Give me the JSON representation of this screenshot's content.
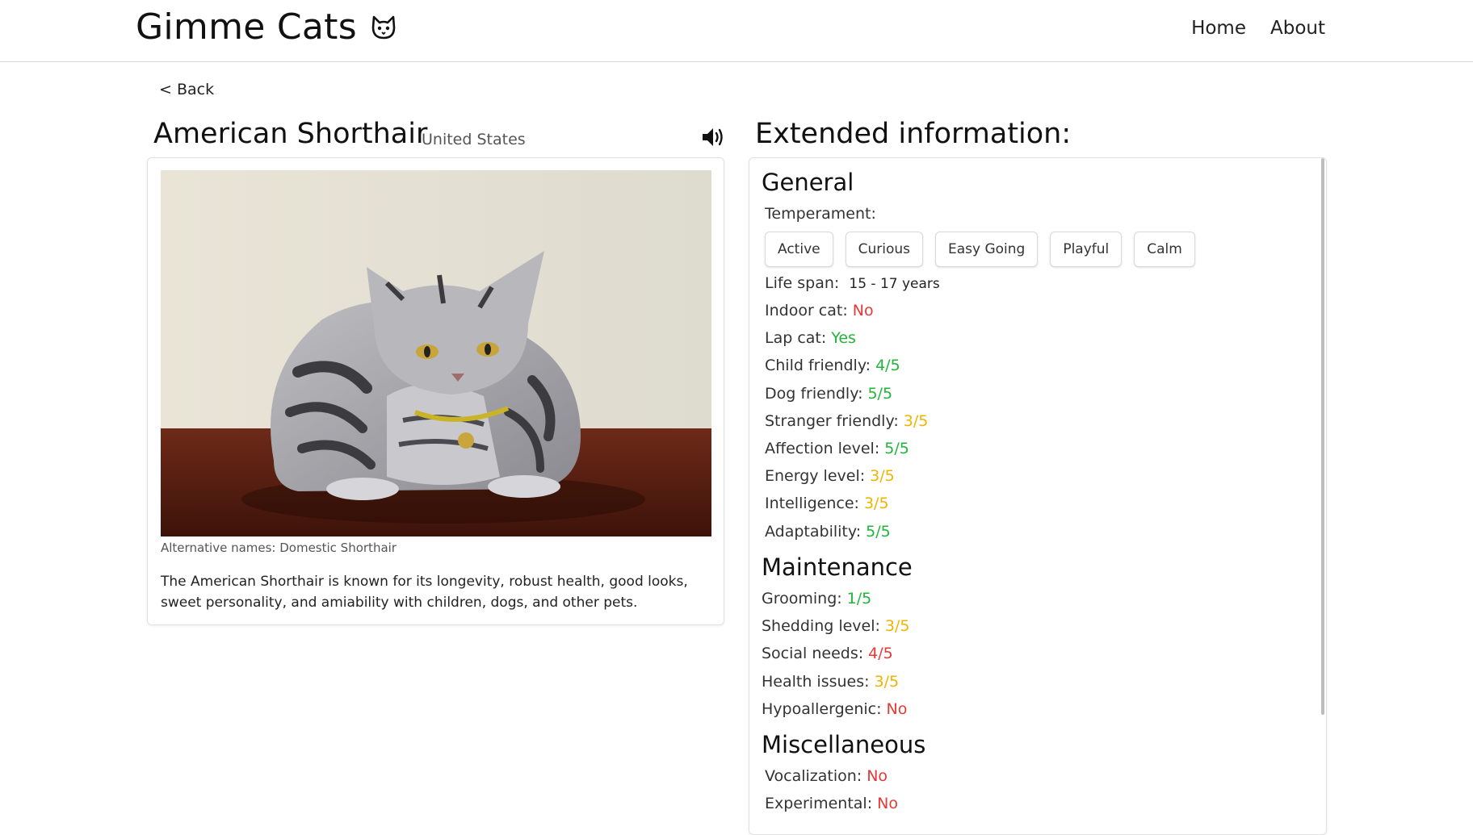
{
  "nav": {
    "brand": "Gimme Cats",
    "brand_icon": "cat-face-icon",
    "links": [
      "Home",
      "About"
    ]
  },
  "back_label": "< Back",
  "breed": {
    "name": "American Shorthair",
    "origin": "United States",
    "sound_icon": "speaker-icon",
    "alt_names": "Alternative names: Domestic Shorthair",
    "description": "The American Shorthair is known for its longevity, robust health, good looks, sweet personality, and amiability with children, dogs, and other pets."
  },
  "extended": {
    "title": "Extended information:",
    "general": {
      "heading": "General",
      "temperament_label": "Temperament:",
      "temperament": [
        "Active",
        "Curious",
        "Easy Going",
        "Playful",
        "Calm"
      ],
      "life_span_label": "Life span:",
      "life_span": "15 - 17 years",
      "rows": [
        {
          "label": "Indoor cat:",
          "value": "No",
          "color": "#e53935"
        },
        {
          "label": "Lap cat:",
          "value": "Yes",
          "color": "#20b53a"
        },
        {
          "label": "Child friendly:",
          "value": "4/5",
          "color": "#20b53a"
        },
        {
          "label": "Dog friendly:",
          "value": "5/5",
          "color": "#20b53a"
        },
        {
          "label": "Stranger friendly:",
          "value": "3/5",
          "color": "#f0b400"
        },
        {
          "label": "Affection level:",
          "value": "5/5",
          "color": "#20b53a"
        },
        {
          "label": "Energy level:",
          "value": "3/5",
          "color": "#f0b400"
        },
        {
          "label": "Intelligence:",
          "value": "3/5",
          "color": "#f0b400"
        },
        {
          "label": "Adaptability:",
          "value": "5/5",
          "color": "#20b53a"
        }
      ]
    },
    "maintenance": {
      "heading": "Maintenance",
      "rows": [
        {
          "label": "Grooming:",
          "value": "1/5",
          "color": "#20b53a"
        },
        {
          "label": "Shedding level:",
          "value": "3/5",
          "color": "#f0b400"
        },
        {
          "label": "Social needs:",
          "value": "4/5",
          "color": "#e53935"
        },
        {
          "label": "Health issues:",
          "value": "3/5",
          "color": "#f0b400"
        },
        {
          "label": "Hypoallergenic:",
          "value": "No",
          "color": "#e53935"
        }
      ]
    },
    "misc": {
      "heading": "Miscellaneous",
      "rows": [
        {
          "label": "Vocalization:",
          "value": "No",
          "color": "#e53935"
        },
        {
          "label": "Experimental:",
          "value": "No",
          "color": "#e53935"
        }
      ]
    }
  }
}
